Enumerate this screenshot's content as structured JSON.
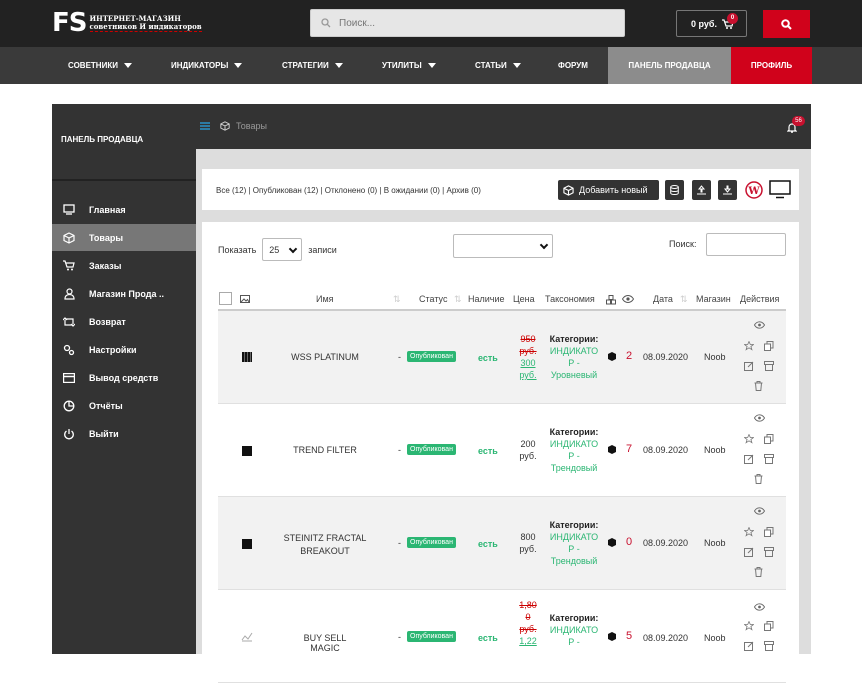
{
  "header": {
    "logo_fs": "FS",
    "logo_line1": "ИНТЕРНЕТ-МАГАЗИН",
    "logo_line2": "советников И индикаторов",
    "search_placeholder": "Поиск...",
    "cart_total": "0 руб.",
    "cart_count": "0"
  },
  "nav": {
    "items": [
      "СОВЕТНИКИ",
      "ИНДИКАТОРЫ",
      "СТРАТЕГИИ",
      "УТИЛИТЫ",
      "СТАТЬИ",
      "ФОРУМ",
      "ПАНЕЛЬ ПРОДАВЦА",
      "ПРОФИЛЬ"
    ]
  },
  "sidebar": {
    "title": "ПАНЕЛЬ ПРОДАВЦА",
    "items": [
      {
        "label": "Главная",
        "icon": "monitor-icon"
      },
      {
        "label": "Товары",
        "icon": "box-icon"
      },
      {
        "label": "Заказы",
        "icon": "cart-icon"
      },
      {
        "label": "Магазин Прода ..",
        "icon": "user-icon"
      },
      {
        "label": "Возврат",
        "icon": "return-icon"
      },
      {
        "label": "Настройки",
        "icon": "settings-icon"
      },
      {
        "label": "Вывод средств",
        "icon": "card-icon"
      },
      {
        "label": "Отчёты",
        "icon": "pie-icon"
      },
      {
        "label": "Выйти",
        "icon": "power-icon"
      }
    ]
  },
  "breadcrumb": {
    "label": "Товары"
  },
  "notifications": {
    "count": "56"
  },
  "filters": {
    "text": "Все (12) | Опубликован (12) | Отклонено (0) | В ожидании (0) | Архив (0)",
    "add_label": "Добавить новый"
  },
  "table_controls": {
    "show_label": "Показать",
    "page_size": "25",
    "records_label": "записи",
    "search_label": "Поиск:"
  },
  "columns": [
    "Имя",
    "Статус",
    "Наличие",
    "Цена",
    "Таксономия",
    "Дата",
    "Магазин",
    "Действия"
  ],
  "rows": [
    {
      "name": "WSS PLATINUM",
      "status": "Опубликован",
      "stock": "есть",
      "old_price": [
        "950",
        "руб."
      ],
      "price": [
        "300",
        "руб."
      ],
      "tax_head": "Категории:",
      "tax_cat": [
        "ИНДИКАТО",
        "Р -"
      ],
      "tax_sub": "Уровневый",
      "views": "2",
      "date": "08.09.2020",
      "store": "Noob"
    },
    {
      "name": "TREND FILTER",
      "status": "Опубликован",
      "stock": "есть",
      "old_price": [],
      "price": [
        "200",
        "руб."
      ],
      "tax_head": "Категории:",
      "tax_cat": [
        "ИНДИКАТО",
        "Р -"
      ],
      "tax_sub": "Трендовый",
      "views": "7",
      "date": "08.09.2020",
      "store": "Noob"
    },
    {
      "name": "STEINITZ FRACTAL BREAKOUT",
      "status": "Опубликован",
      "stock": "есть",
      "old_price": [],
      "price": [
        "800",
        "руб."
      ],
      "tax_head": "Категории:",
      "tax_cat": [
        "ИНДИКАТО",
        "Р -"
      ],
      "tax_sub": "Трендовый",
      "views": "0",
      "date": "08.09.2020",
      "store": "Noob"
    },
    {
      "name": "BUY SELL MAGIC",
      "status": "Опубликован",
      "stock": "есть",
      "old_price": [
        "1,80",
        "0",
        "руб."
      ],
      "price": [
        "1,22"
      ],
      "tax_head": "Категории:",
      "tax_cat": [
        "ИНДИКАТО",
        "Р -"
      ],
      "tax_sub": "",
      "views": "5",
      "date": "08.09.2020",
      "store": "Noob"
    }
  ],
  "colors": {
    "accent": "#d0021b",
    "published": "#2bb673",
    "dark": "#333333"
  }
}
